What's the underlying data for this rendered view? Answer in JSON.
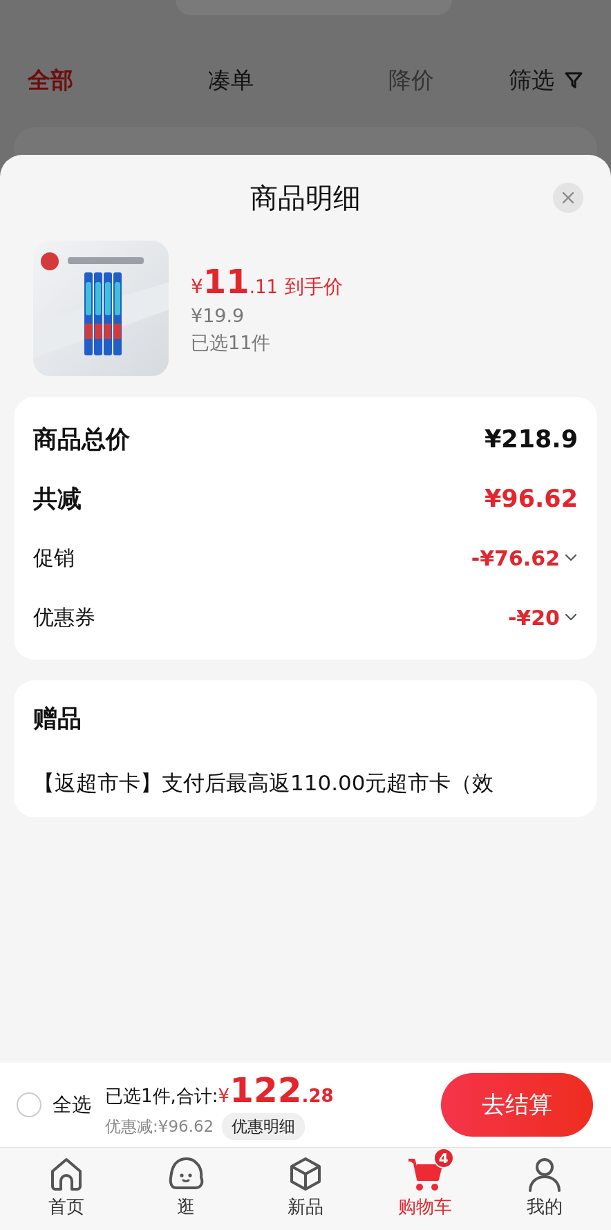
{
  "filter_tabs": [
    {
      "label": "全部",
      "selected": true,
      "disabled": false
    },
    {
      "label": "凑单",
      "selected": false,
      "disabled": false
    },
    {
      "label": "降价",
      "selected": false,
      "disabled": true
    }
  ],
  "filter_button": "筛选",
  "sheet": {
    "title": "商品明细",
    "product": {
      "currency": "¥",
      "price_int": "11",
      "price_dec": ".11",
      "price_label": "到手价",
      "original_price": "¥19.9",
      "selected_count": "已选11件"
    },
    "summary": [
      {
        "kind": "total",
        "label": "商品总价",
        "value": "¥218.9"
      },
      {
        "kind": "discount",
        "label": "共减",
        "value": "¥96.62"
      },
      {
        "kind": "detail",
        "label": "促销",
        "value": "-¥76.62"
      },
      {
        "kind": "detail",
        "label": "优惠券",
        "value": "-¥20"
      }
    ],
    "gift": {
      "title": "赠品",
      "text": "【返超市卡】支付后最高返110.00元超市卡（效"
    }
  },
  "checkout": {
    "select_all": {
      "label": "全选",
      "checked": false
    },
    "summary": "已选1件,合计:",
    "currency": "¥",
    "total_int": "122",
    "total_dec": ".28",
    "saving": "优惠减:¥96.62",
    "detail_button": "优惠明细",
    "button": "去结算"
  },
  "tab_bar": [
    {
      "label": "首页",
      "kind": "home",
      "selected": false
    },
    {
      "label": "逛",
      "kind": "mascot",
      "selected": false
    },
    {
      "label": "新品",
      "kind": "new",
      "selected": false
    },
    {
      "label": "购物车",
      "kind": "cart",
      "selected": true,
      "badge": "4"
    },
    {
      "label": "我的",
      "kind": "profile",
      "selected": false
    }
  ]
}
